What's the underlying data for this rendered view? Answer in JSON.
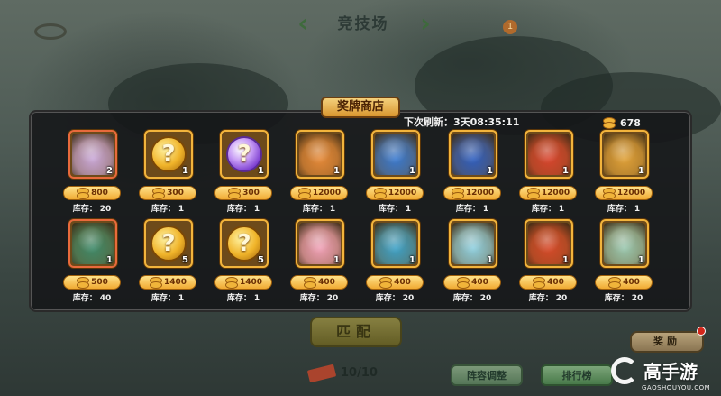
{
  "header": {
    "title": "竞技场",
    "notification_count": "1"
  },
  "shop": {
    "title": "奖牌商店",
    "refresh_label": "下次刷新：",
    "refresh_time": "3天08:35:11",
    "currency_amount": "678",
    "stock_label": "库存："
  },
  "items": [
    {
      "kind": "hero",
      "portrait": "white-tiger",
      "color": "#c9a8d8",
      "qty": "2",
      "price": "800",
      "stock": "20"
    },
    {
      "kind": "gold-orb",
      "qty": "1",
      "price": "300",
      "stock": "1"
    },
    {
      "kind": "purple-orb",
      "qty": "1",
      "price": "300",
      "stock": "1"
    },
    {
      "kind": "hero",
      "portrait": "fire-fox",
      "color": "#e58a3a",
      "qty": "1",
      "price": "12000",
      "stock": "1"
    },
    {
      "kind": "hero",
      "portrait": "blue-dragon",
      "color": "#3a7ad0",
      "qty": "1",
      "price": "12000",
      "stock": "1"
    },
    {
      "kind": "hero",
      "portrait": "blue-beast",
      "color": "#2f5fc0",
      "qty": "1",
      "price": "12000",
      "stock": "1"
    },
    {
      "kind": "hero",
      "portrait": "red-phoenix",
      "color": "#d8452e",
      "qty": "1",
      "price": "12000",
      "stock": "1"
    },
    {
      "kind": "hero",
      "portrait": "golden-lion",
      "color": "#e0a23a",
      "qty": "1",
      "price": "12000",
      "stock": "1"
    },
    {
      "kind": "hero",
      "portrait": "green-dragon",
      "color": "#3f8a6a",
      "qty": "1",
      "price": "500",
      "stock": "40"
    },
    {
      "kind": "gold-orb",
      "qty": "5",
      "price": "1400",
      "stock": "1"
    },
    {
      "kind": "gold-orb",
      "qty": "5",
      "price": "1400",
      "stock": "1"
    },
    {
      "kind": "hero",
      "portrait": "pink-unicorn",
      "color": "#f0a2b8",
      "qty": "1",
      "price": "400",
      "stock": "20"
    },
    {
      "kind": "hero",
      "portrait": "sea-dragon",
      "color": "#3ea2c8",
      "qty": "1",
      "price": "400",
      "stock": "20"
    },
    {
      "kind": "hero",
      "portrait": "ice-dragon",
      "color": "#8fd0e0",
      "qty": "1",
      "price": "400",
      "stock": "20"
    },
    {
      "kind": "hero",
      "portrait": "golden-mask",
      "color": "#d64a2a",
      "qty": "1",
      "price": "400",
      "stock": "20"
    },
    {
      "kind": "hero",
      "portrait": "white-dragon",
      "color": "#9ac8b0",
      "qty": "1",
      "price": "400",
      "stock": "20"
    }
  ],
  "buttons": {
    "match": "匹配",
    "lineup": "阵容调整",
    "ranking": "排行榜",
    "reward": "奖励"
  },
  "tickets": "10/10",
  "watermark": {
    "name": "高手游",
    "url": "GAOSHOUYOU.COM"
  }
}
